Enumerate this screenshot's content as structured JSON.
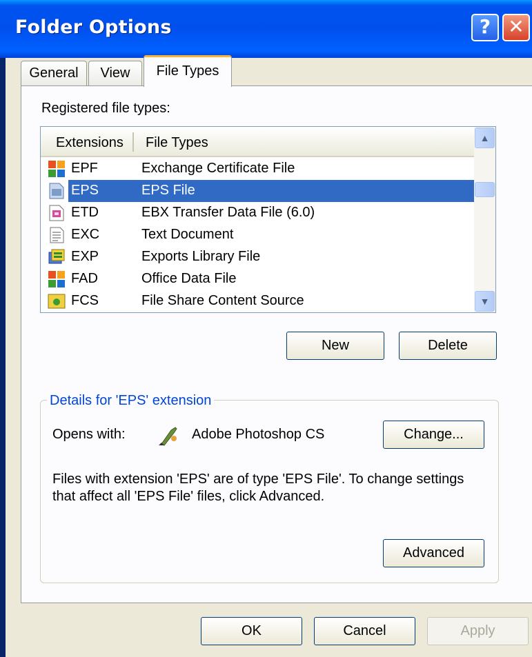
{
  "window": {
    "title": "Folder Options",
    "help_glyph": "?",
    "close_glyph": "✕"
  },
  "tabs": [
    {
      "label": "General"
    },
    {
      "label": "View"
    },
    {
      "label": "File Types",
      "selected": true
    }
  ],
  "file_types": {
    "label": "Registered file types:",
    "columns": [
      "Extensions",
      "File Types"
    ],
    "rows": [
      {
        "ext": "EPF",
        "type": "Exchange Certificate File",
        "icon": "office-data-icon"
      },
      {
        "ext": "EPS",
        "type": "EPS File",
        "icon": "eps-file-icon",
        "selected": true
      },
      {
        "ext": "ETD",
        "type": "EBX Transfer Data File (6.0)",
        "icon": "ebx-file-icon"
      },
      {
        "ext": "EXC",
        "type": "Text Document",
        "icon": "text-document-icon"
      },
      {
        "ext": "EXP",
        "type": "Exports Library File",
        "icon": "exports-library-icon"
      },
      {
        "ext": "FAD",
        "type": "Office Data File",
        "icon": "office-data-icon"
      },
      {
        "ext": "FCS",
        "type": "File Share Content Source",
        "icon": "file-share-icon"
      }
    ],
    "scrollbar_up": "▲",
    "scrollbar_down": "▼",
    "new_button": "New",
    "delete_button": "Delete"
  },
  "details": {
    "title": "Details for 'EPS' extension",
    "opens_with_label": "Opens with:",
    "app_name": "Adobe Photoshop CS",
    "app_icon": "photoshop-icon",
    "change_button": "Change...",
    "description": "Files with extension 'EPS' are of type 'EPS File'.  To change settings that affect all 'EPS File' files, click Advanced.",
    "advanced_button": "Advanced"
  },
  "footer": {
    "ok": "OK",
    "cancel": "Cancel",
    "apply": "Apply"
  },
  "colors": {
    "titlebar": "#0054e3",
    "selection": "#316ac5",
    "group_title": "#0046d5",
    "dialog_bg": "#ece9d8"
  }
}
